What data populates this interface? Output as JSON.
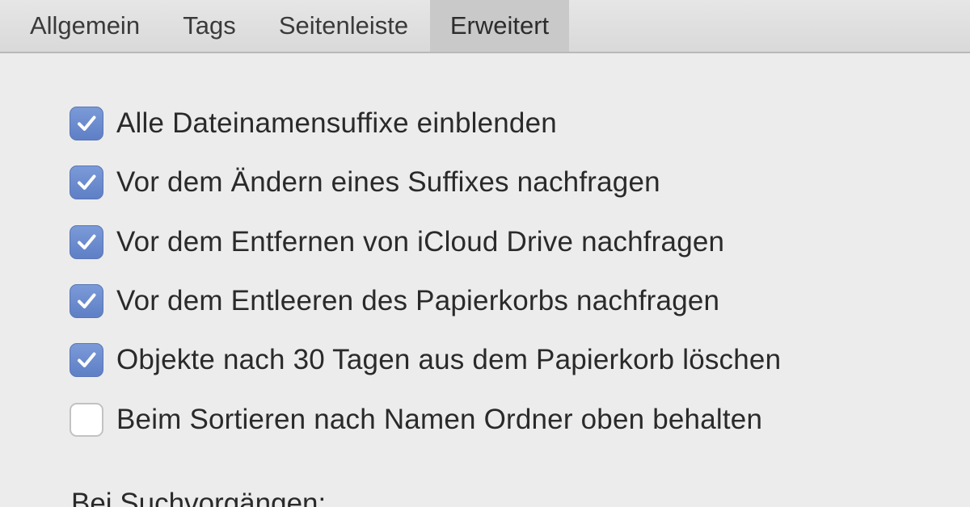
{
  "tabs": [
    {
      "label": "Allgemein"
    },
    {
      "label": "Tags"
    },
    {
      "label": "Seitenleiste"
    },
    {
      "label": "Erweitert",
      "selected": true
    }
  ],
  "options": [
    {
      "label": "Alle Dateinamensuffixe einblenden",
      "checked": true
    },
    {
      "label": "Vor dem Ändern eines Suffixes nachfragen",
      "checked": true
    },
    {
      "label": "Vor dem Entfernen von iCloud Drive nachfragen",
      "checked": true
    },
    {
      "label": "Vor dem Entleeren des Papierkorbs nachfragen",
      "checked": true
    },
    {
      "label": "Objekte nach 30 Tagen aus dem Papierkorb löschen",
      "checked": true
    },
    {
      "label": "Beim Sortieren nach Namen Ordner oben behalten",
      "checked": false
    }
  ],
  "search_section": {
    "label": "Bei Suchvorgängen:"
  },
  "colors": {
    "checkbox_accent": "#6a8ace",
    "selected_tab": "#c9c9c9",
    "window_background": "#ececec"
  }
}
